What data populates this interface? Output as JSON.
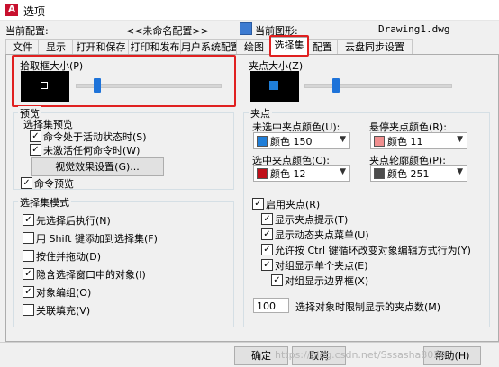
{
  "window": {
    "title": "选项",
    "app_icon": "autocad-icon"
  },
  "config": {
    "current_config_label": "当前配置:",
    "current_config_value": "<<未命名配置>>",
    "current_drawing_label": "当前图形:",
    "current_drawing_value": "Drawing1.dwg"
  },
  "tabs": [
    "文件",
    "显示",
    "打开和保存",
    "打印和发布",
    "用户系统配置",
    "绘图",
    "选择集",
    "配置",
    "云盘同步设置"
  ],
  "active_tab": "选择集",
  "pickbox": {
    "label": "拾取框大小(P)",
    "slider_fraction": 0.15
  },
  "grip_size": {
    "label": "夹点大小(Z)",
    "slider_fraction": 0.35
  },
  "preview": {
    "group_label": "预览",
    "subgroup_label": "选择集预览",
    "active_command": "命令处于活动状态时(S)",
    "no_active_command": "未激活任何命令时(W)",
    "visual_effects_button": "视觉效果设置(G)...",
    "command_preview": "命令预览"
  },
  "selection_modes": {
    "group_label": "选择集模式",
    "items": [
      {
        "label": "先选择后执行(N)",
        "checked": true
      },
      {
        "label": "用 Shift 键添加到选择集(F)",
        "checked": false
      },
      {
        "label": "按住并拖动(D)",
        "checked": false
      },
      {
        "label": "隐含选择窗口中的对象(I)",
        "checked": true
      },
      {
        "label": "对象编组(O)",
        "checked": true
      },
      {
        "label": "关联填充(V)",
        "checked": false
      }
    ]
  },
  "grips": {
    "group_label": "夹点",
    "unselected_color_label": "未选中夹点颜色(U):",
    "unselected_color_value": "颜色 150",
    "hover_color_label": "悬停夹点颜色(R):",
    "hover_color_value": "颜色 11",
    "selected_color_label": "选中夹点颜色(C):",
    "selected_color_value": "颜色 12",
    "contour_color_label": "夹点轮廓颜色(P):",
    "contour_color_value": "颜色 251",
    "enable_grips": "启用夹点(R)",
    "show_tips": "显示夹点提示(T)",
    "show_dynamic_menu": "显示动态夹点菜单(U)",
    "allow_ctrl_cycle": "允许按 Ctrl 键循环改变对象编辑方式行为(Y)",
    "single_grip_group": "对组显示单个夹点(E)",
    "bbox_group": "对组显示边界框(X)",
    "limit_value": "100",
    "limit_label": "选择对象时限制显示的夹点数(M)"
  },
  "footer": {
    "ok_button": "确定",
    "cancel_button": "取消",
    "help_button": "帮助(H)"
  },
  "watermark": "https://blog.csdn.net/Sssasha8020",
  "colors": {
    "color150": "#1f7ed8",
    "color11": "#f08f8f",
    "color12": "#c0101a",
    "color251": "#4c4c4c",
    "accent": "#1e73d9",
    "highlight": "#e02020"
  }
}
